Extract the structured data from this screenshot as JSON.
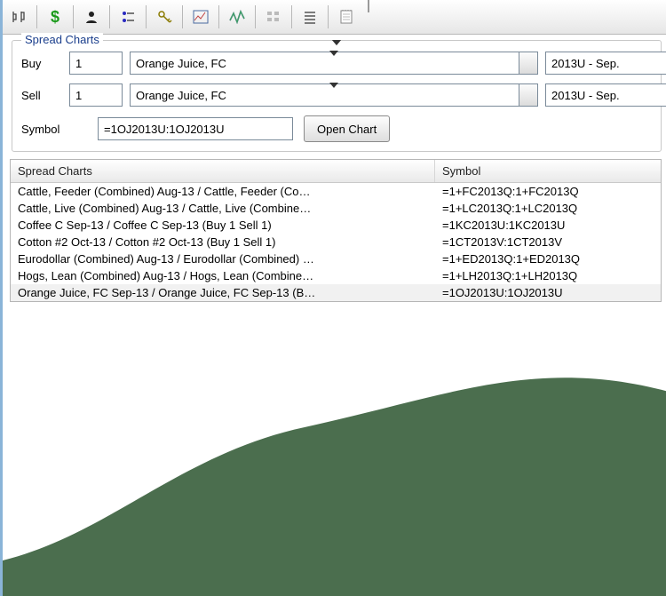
{
  "group": {
    "title": "Spread Charts"
  },
  "buy": {
    "label": "Buy",
    "qty": "1",
    "instrument": "Orange Juice, FC",
    "month": "2013U - Sep."
  },
  "sell": {
    "label": "Sell",
    "qty": "1",
    "instrument": "Orange Juice, FC",
    "month": "2013U - Sep."
  },
  "symbol": {
    "label": "Symbol",
    "value": "=1OJ2013U:1OJ2013U"
  },
  "openChart": "Open Chart",
  "table": {
    "columns": [
      "Spread Charts",
      "Symbol"
    ],
    "rows": [
      {
        "name": "Cattle, Feeder (Combined) Aug-13  / Cattle, Feeder (Co…",
        "symbol": "=1+FC2013Q:1+FC2013Q"
      },
      {
        "name": "Cattle, Live (Combined) Aug-13  / Cattle, Live (Combine…",
        "symbol": "=1+LC2013Q:1+LC2013Q"
      },
      {
        "name": "Coffee C Sep-13  / Coffee C Sep-13 (Buy 1 Sell 1)",
        "symbol": "=1KC2013U:1KC2013U"
      },
      {
        "name": "Cotton #2 Oct-13  / Cotton #2 Oct-13 (Buy 1 Sell 1)",
        "symbol": "=1CT2013V:1CT2013V"
      },
      {
        "name": "Eurodollar (Combined) Aug-13  / Eurodollar (Combined) …",
        "symbol": "=1+ED2013Q:1+ED2013Q"
      },
      {
        "name": "Hogs, Lean (Combined) Aug-13  / Hogs, Lean (Combine…",
        "symbol": "=1+LH2013Q:1+LH2013Q"
      },
      {
        "name": "Orange Juice, FC Sep-13  / Orange Juice, FC Sep-13 (B…",
        "symbol": "=1OJ2013U:1OJ2013U"
      }
    ],
    "selectedIndex": 6
  },
  "colors": {
    "hill": "#4b6e4e"
  }
}
